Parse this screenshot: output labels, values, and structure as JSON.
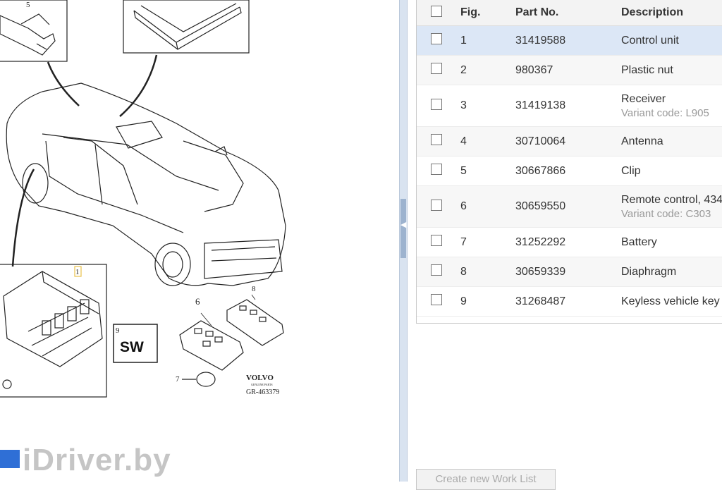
{
  "diagram": {
    "callouts": [
      "5",
      "1",
      "9",
      "6",
      "8",
      "7"
    ],
    "sw_label": "SW",
    "brand": "VOLVO",
    "brand_sub": "GENUINE PARTS",
    "ref": "GR-463379"
  },
  "table": {
    "headers": {
      "fig": "Fig.",
      "part": "Part No.",
      "desc": "Description"
    },
    "rows": [
      {
        "fig": "1",
        "part": "31419588",
        "desc": "Control unit",
        "sub": ""
      },
      {
        "fig": "2",
        "part": "980367",
        "desc": "Plastic nut",
        "sub": ""
      },
      {
        "fig": "3",
        "part": "31419138",
        "desc": "Receiver",
        "sub": "Variant code: L905"
      },
      {
        "fig": "4",
        "part": "30710064",
        "desc": "Antenna",
        "sub": ""
      },
      {
        "fig": "5",
        "part": "30667866",
        "desc": "Clip",
        "sub": ""
      },
      {
        "fig": "6",
        "part": "30659550",
        "desc": "Remote control, 434",
        "sub": "Variant code: C303"
      },
      {
        "fig": "7",
        "part": "31252292",
        "desc": "Battery",
        "sub": ""
      },
      {
        "fig": "8",
        "part": "30659339",
        "desc": "Diaphragm",
        "sub": ""
      },
      {
        "fig": "9",
        "part": "31268487",
        "desc": "Keyless vehicle key",
        "sub": ""
      }
    ]
  },
  "create_worklist_label": "Create new Work List",
  "watermark": "iDriver.by",
  "colors": {
    "selected_row": "#dce7f6",
    "watermark_mark": "#2f6fd6"
  }
}
